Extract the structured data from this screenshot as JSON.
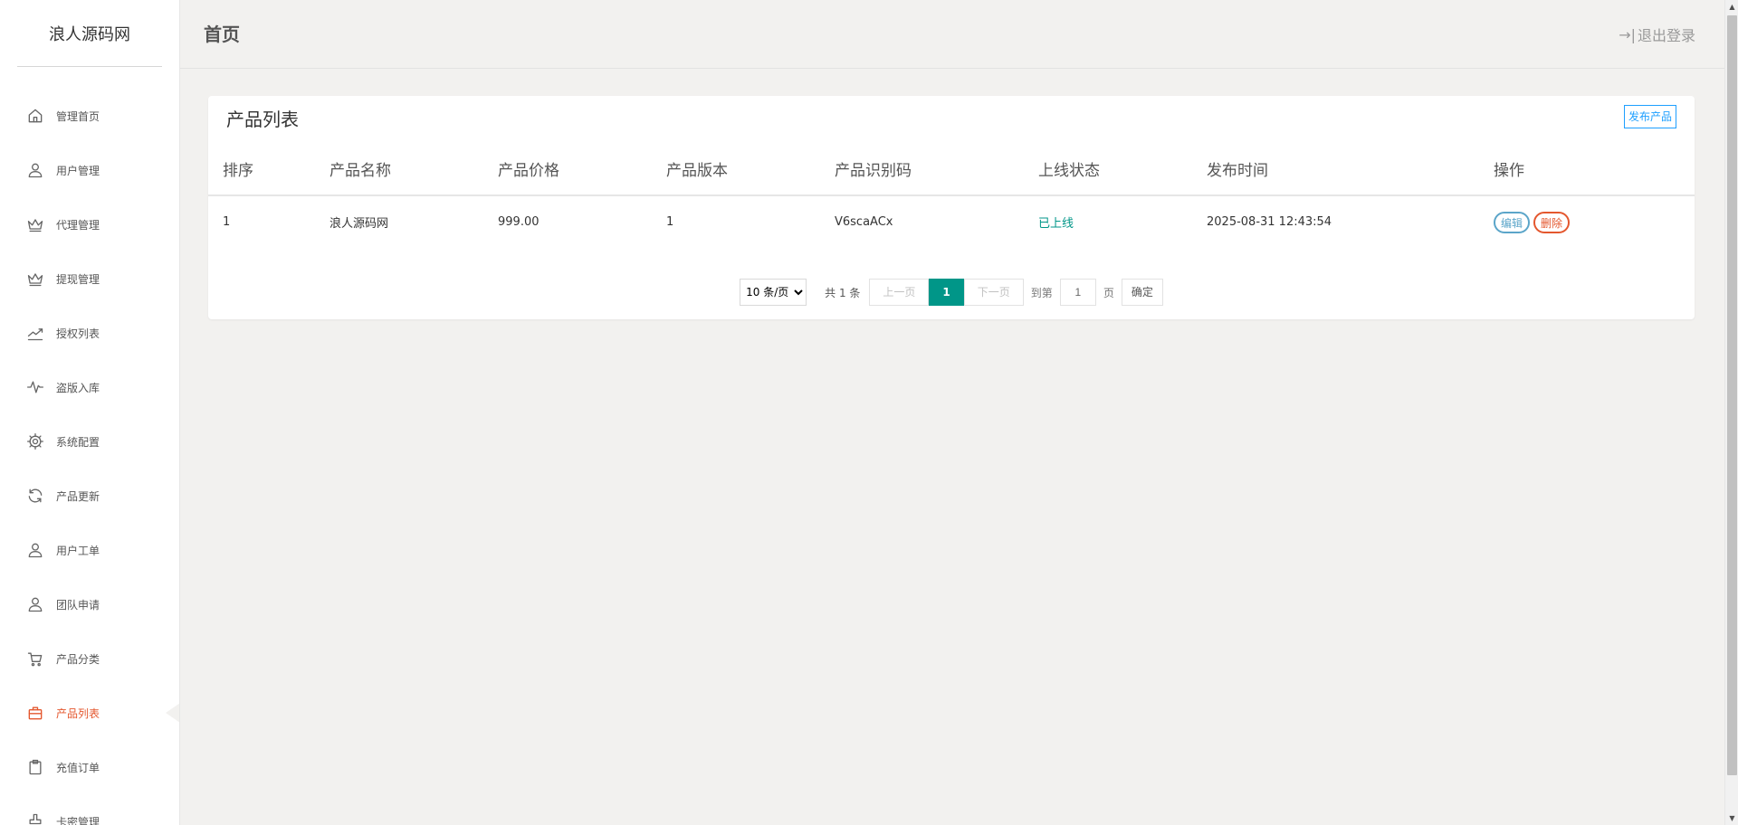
{
  "brand": "浪人源码网",
  "header": {
    "title": "首页",
    "logout": "退出登录"
  },
  "sidebar": {
    "items": [
      {
        "label": "管理首页",
        "icon": "home-icon"
      },
      {
        "label": "用户管理",
        "icon": "user-icon"
      },
      {
        "label": "代理管理",
        "icon": "crown-icon"
      },
      {
        "label": "提现管理",
        "icon": "crown-icon"
      },
      {
        "label": "授权列表",
        "icon": "trend-icon"
      },
      {
        "label": "盗版入库",
        "icon": "pulse-icon"
      },
      {
        "label": "系统配置",
        "icon": "gear-icon"
      },
      {
        "label": "产品更新",
        "icon": "refresh-icon"
      },
      {
        "label": "用户工单",
        "icon": "user-icon"
      },
      {
        "label": "团队申请",
        "icon": "user-icon"
      },
      {
        "label": "产品分类",
        "icon": "cart-icon"
      },
      {
        "label": "产品列表",
        "icon": "bag-icon",
        "active": true
      },
      {
        "label": "充值订单",
        "icon": "clipboard-icon"
      },
      {
        "label": "卡密管理",
        "icon": "stamp-icon"
      }
    ]
  },
  "card": {
    "title": "产品列表",
    "publish": "发布产品",
    "columns": [
      "排序",
      "产品名称",
      "产品价格",
      "产品版本",
      "产品识别码",
      "上线状态",
      "发布时间",
      "操作"
    ],
    "rows": [
      {
        "order": "1",
        "name": "浪人源码网",
        "price": "999.00",
        "version": "1",
        "code": "V6scaACx",
        "status": "已上线",
        "time": "2025-08-31 12:43:54",
        "edit": "编辑",
        "delete": "删除"
      }
    ]
  },
  "pager": {
    "page_size": "10 条/页",
    "total": "共 1 条",
    "prev": "上一页",
    "current": "1",
    "next": "下一页",
    "goto": "到第",
    "goto_value": "1",
    "page_unit": "页",
    "confirm": "确定"
  },
  "colors": {
    "accent": "#e4572e",
    "primary": "#009688",
    "link": "#1e9fff"
  }
}
